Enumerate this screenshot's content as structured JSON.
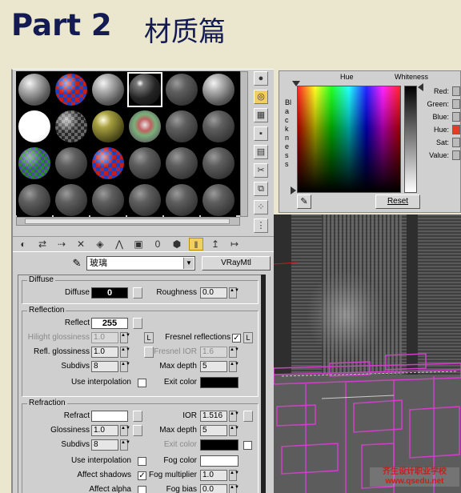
{
  "header": {
    "part": "Part 2",
    "chapter": "材质篇"
  },
  "material_editor": {
    "slots": [
      [
        "gray",
        "checker",
        "gray",
        "glass",
        "dark",
        "gray"
      ],
      [
        "white",
        "checker2",
        "olive",
        "house",
        "dark",
        "dark"
      ],
      [
        "checker3",
        "dark",
        "checker",
        "dark",
        "dark",
        "dark"
      ],
      [
        "dark",
        "dark",
        "dark",
        "dark",
        "dark",
        "dark"
      ]
    ],
    "active_slot": [
      0,
      3
    ],
    "side_tools": [
      "sphere-icon",
      "backlight-icon",
      "checker-background-icon",
      "sample-uv-icon",
      "video-color-check-icon",
      "make-preview-icon",
      "options-icon",
      "select-by-material-icon",
      "material-navigator-icon"
    ],
    "toolbar": [
      "get-material-icon",
      "put-to-scene-icon",
      "assign-to-selection-icon",
      "reset-icon",
      "make-copy-icon",
      "make-unique-icon",
      "put-to-library-icon",
      "material-id-icon",
      "show-map-icon",
      "show-end-result-icon",
      "go-to-parent-icon",
      "go-forward-icon"
    ],
    "material_name": "玻璃",
    "material_type": "VRayMtl",
    "diffuse": {
      "title": "Diffuse",
      "diffuse_label": "Diffuse",
      "diffuse_value": "0",
      "roughness_label": "Roughness",
      "roughness_value": "0.0"
    },
    "reflection": {
      "title": "Reflection",
      "reflect_label": "Reflect",
      "reflect_value": "255",
      "hilight_label": "Hilight glossiness",
      "hilight_value": "1.0",
      "hilight_lock": "L",
      "fresnel_label": "Fresnel reflections",
      "fresnel_checked": "✓",
      "fresnel_lock": "L",
      "refl_gloss_label": "Refl. glossiness",
      "refl_gloss_value": "1.0",
      "fresnel_ior_label": "Fresnel IOR",
      "fresnel_ior_value": "1.6",
      "subdivs_label": "Subdivs",
      "subdivs_value": "8",
      "max_depth_label": "Max depth",
      "max_depth_value": "5",
      "use_interp_label": "Use interpolation",
      "exit_color_label": "Exit color"
    },
    "refraction": {
      "title": "Refraction",
      "refract_label": "Refract",
      "ior_label": "IOR",
      "ior_value": "1.516",
      "gloss_label": "Glossiness",
      "gloss_value": "1.0",
      "max_depth_label": "Max depth",
      "max_depth_value": "5",
      "subdivs_label": "Subdivs",
      "subdivs_value": "8",
      "exit_color_label": "Exit color",
      "use_interp_label": "Use interpolation",
      "fog_color_label": "Fog color",
      "affect_shadows_label": "Affect shadows",
      "affect_shadows_checked": "✓",
      "fog_mult_label": "Fog multiplier",
      "fog_mult_value": "1.0",
      "affect_alpha_label": "Affect alpha",
      "fog_bias_label": "Fog bias",
      "fog_bias_value": "0.0"
    }
  },
  "color_picker": {
    "hue_label": "Hue",
    "whiteness_label": "Whiteness",
    "blackness_label": "Blackness",
    "channels": [
      "Red:",
      "Green:",
      "Blue:",
      "Hue:",
      "Sat:",
      "Value:"
    ],
    "reset_label": "Reset"
  },
  "watermark": {
    "line1": "齐生设计职业学校",
    "line2": "www.qsedu.net"
  },
  "colors": {
    "title": "#141b52",
    "background": "#ebe7cf",
    "panel": "#cfcfcf",
    "accent_toggle": "#f0d060",
    "viewport_objects": "#d040c8",
    "watermark": "#c81e1e"
  }
}
